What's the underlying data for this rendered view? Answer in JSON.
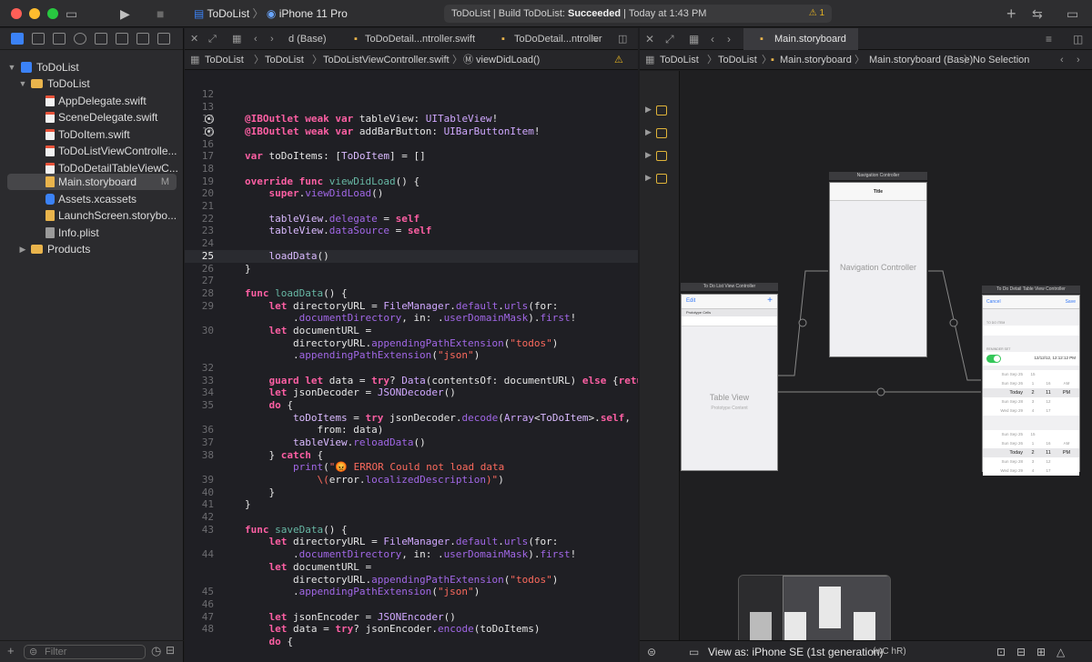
{
  "toolbar": {
    "scheme_project": "ToDoList",
    "scheme_device": "iPhone 11 Pro",
    "activity_prefix": "ToDoList | Build ToDoList: ",
    "activity_status": "Succeeded",
    "activity_time": " | Today at 1:43 PM",
    "warning_count": "1"
  },
  "navigator": {
    "items": [
      {
        "label": "ToDoList"
      },
      {
        "label": "ToDoList"
      },
      {
        "label": "AppDelegate.swift"
      },
      {
        "label": "SceneDelegate.swift"
      },
      {
        "label": "ToDoItem.swift"
      },
      {
        "label": "ToDoListViewControlle..."
      },
      {
        "label": "ToDoDetailTableViewC..."
      },
      {
        "label": "Main.storyboard",
        "badge": "M"
      },
      {
        "label": "Assets.xcassets"
      },
      {
        "label": "LaunchScreen.storybo..."
      },
      {
        "label": "Info.plist"
      },
      {
        "label": "Products"
      }
    ],
    "filter_placeholder": "Filter"
  },
  "editor": {
    "tabs": [
      "d (Base)",
      "ToDoDetail...ntroller.swift",
      "ToDoDetail...ntroller"
    ],
    "jump_bar": [
      "ToDoList",
      "ToDoList",
      "ToDoListViewController.swift",
      "viewDidLoad()"
    ],
    "current_line": "25",
    "line_numbers": [
      "12",
      "13",
      "14",
      "15",
      "16",
      "17",
      "18",
      "19",
      "20",
      "21",
      "22",
      "23",
      "24",
      "25",
      "26",
      "27",
      "28",
      "29",
      "",
      "30",
      "",
      "",
      "32",
      "33",
      "34",
      "35",
      "",
      "36",
      "37",
      "38",
      "",
      "39",
      "40",
      "41",
      "42",
      "43",
      "",
      "44",
      "",
      "",
      "45",
      "46",
      "47",
      "48"
    ]
  },
  "ib": {
    "active_tab": "Main.storyboard",
    "jump_bar": [
      "ToDoList",
      "ToDoList",
      "Main.storyboard",
      "Main.storyboard (Base)",
      "No Selection"
    ],
    "view_as": "View as: iPhone SE (1st generation)",
    "view_as_shortcut": "(wC hR)",
    "scenes": {
      "list_title": "To Do List View Controller",
      "list_edit": "Edit",
      "list_add": "+",
      "prototype_cells": "Prototype Cells",
      "table_view": "Table View",
      "prototype_content": "Prototype Content",
      "nav_title": "Navigation Controller",
      "nav_bar_title": "Title",
      "nav_center": "Navigation Controller",
      "detail_title": "To Do Detail Table View Controller",
      "detail_cancel": "Cancel",
      "detail_save": "Save",
      "detail_item": "TO DO ITEM",
      "detail_remind": "REMINDER SET",
      "detail_date": "12/12/12, 12:12:12 PM",
      "picker_rows": [
        {
          "d": "Sun Sep 25",
          "h": "15",
          "m": "",
          "ap": ""
        },
        {
          "d": "Sun Sep 26",
          "h": "1",
          "m": "16",
          "ap": "AM"
        },
        {
          "d": "Today",
          "h": "2",
          "m": "11",
          "ap": "PM"
        },
        {
          "d": "Sun Sep 28",
          "h": "3",
          "m": "12",
          "ap": ""
        },
        {
          "d": "Wed Sep 29",
          "h": "4",
          "m": "17",
          "ap": ""
        }
      ]
    }
  }
}
